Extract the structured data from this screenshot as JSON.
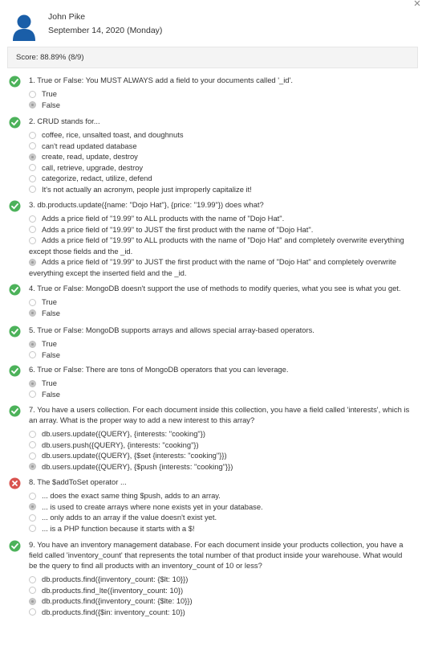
{
  "user": {
    "name": "John Pike",
    "date": "September 14, 2020 (Monday)"
  },
  "score": "Score: 88.89% (8/9)",
  "colors": {
    "correct": "#4cb25a",
    "incorrect": "#d9534f",
    "selected_radio": "#c9c9c9"
  },
  "questions": [
    {
      "text": "1. True or False: You MUST ALWAYS add a field to your documents called '_id'.",
      "result": "correct",
      "options": [
        {
          "label": "True",
          "selected": false
        },
        {
          "label": "False",
          "selected": true
        }
      ]
    },
    {
      "text": "2. CRUD stands for...",
      "result": "correct",
      "options": [
        {
          "label": "coffee, rice, unsalted toast, and doughnuts",
          "selected": false
        },
        {
          "label": "can't read updated database",
          "selected": false
        },
        {
          "label": "create, read, update, destroy",
          "selected": true
        },
        {
          "label": "call, retrieve, upgrade, destroy",
          "selected": false
        },
        {
          "label": "categorize, redact, utilize, defend",
          "selected": false
        },
        {
          "label": "It's not actually an acronym, people just improperly capitalize it!",
          "selected": false
        }
      ]
    },
    {
      "text": "3. db.products.update({name: \"Dojo Hat\"}, {price: \"19.99\"}) does what?",
      "result": "correct",
      "options": [
        {
          "label": "Adds a price field of \"19.99\" to ALL products with the name of \"Dojo Hat\".",
          "selected": false
        },
        {
          "label": "Adds a price field of \"19.99\" to JUST the first product with the name of \"Dojo Hat\".",
          "selected": false
        },
        {
          "label": "Adds a price field of \"19.99\" to ALL products with the name of \"Dojo Hat\" and completely overwrite everything except those fields and the _id.",
          "selected": false
        },
        {
          "label": "Adds a price field of \"19.99\" to JUST the first product with the name of \"Dojo Hat\" and completely overwrite everything except the inserted field and the _id.",
          "selected": true
        }
      ]
    },
    {
      "text": "4. True or False: MongoDB doesn't support the use of methods to modify queries, what you see is what you get.",
      "result": "correct",
      "options": [
        {
          "label": "True",
          "selected": false
        },
        {
          "label": "False",
          "selected": true
        }
      ]
    },
    {
      "text": "5. True or False: MongoDB supports arrays and allows special array-based operators.",
      "result": "correct",
      "options": [
        {
          "label": "True",
          "selected": true
        },
        {
          "label": "False",
          "selected": false
        }
      ]
    },
    {
      "text": "6. True or False: There are tons of MongoDB operators that you can leverage.",
      "result": "correct",
      "options": [
        {
          "label": "True",
          "selected": true
        },
        {
          "label": "False",
          "selected": false
        }
      ]
    },
    {
      "text": "7. You have a users collection. For each document inside this collection, you have a field called 'interests', which is an array. What is the proper way to add a new interest to this array?",
      "result": "correct",
      "options": [
        {
          "label": "db.users.update({QUERY}, {interests: \"cooking\"})",
          "selected": false
        },
        {
          "label": "db.users.push({QUERY}, {interests: \"cooking\"})",
          "selected": false
        },
        {
          "label": "db.users.update({QUERY}, {$set {interests: \"cooking\"}})",
          "selected": false
        },
        {
          "label": "db.users.update({QUERY}, {$push {interests: \"cooking\"}})",
          "selected": true
        }
      ]
    },
    {
      "text": "8. The $addToSet operator ...",
      "result": "incorrect",
      "options": [
        {
          "label": "... does the exact same thing $push, adds to an array.",
          "selected": false
        },
        {
          "label": "... is used to create arrays where none exists yet in your database.",
          "selected": true
        },
        {
          "label": "... only adds to an array if the value doesn't exist yet.",
          "selected": false
        },
        {
          "label": "... is a PHP function because it starts with a $!",
          "selected": false
        }
      ]
    },
    {
      "text": "9. You have an inventory management database. For each document inside your products collection, you have a field called 'inventory_count' that represents the total number of that product inside your warehouse. What would be the query to find all products with an inventory_count of 10 or less?",
      "result": "correct",
      "options": [
        {
          "label": "db.products.find({inventory_count: {$lt: 10}})",
          "selected": false
        },
        {
          "label": "db.products.find_lte({inventory_count: 10})",
          "selected": false
        },
        {
          "label": "db.products.find({inventory_count: {$lte: 10}})",
          "selected": true
        },
        {
          "label": "db.products.find({$in: inventory_count: 10})",
          "selected": false
        }
      ]
    }
  ]
}
